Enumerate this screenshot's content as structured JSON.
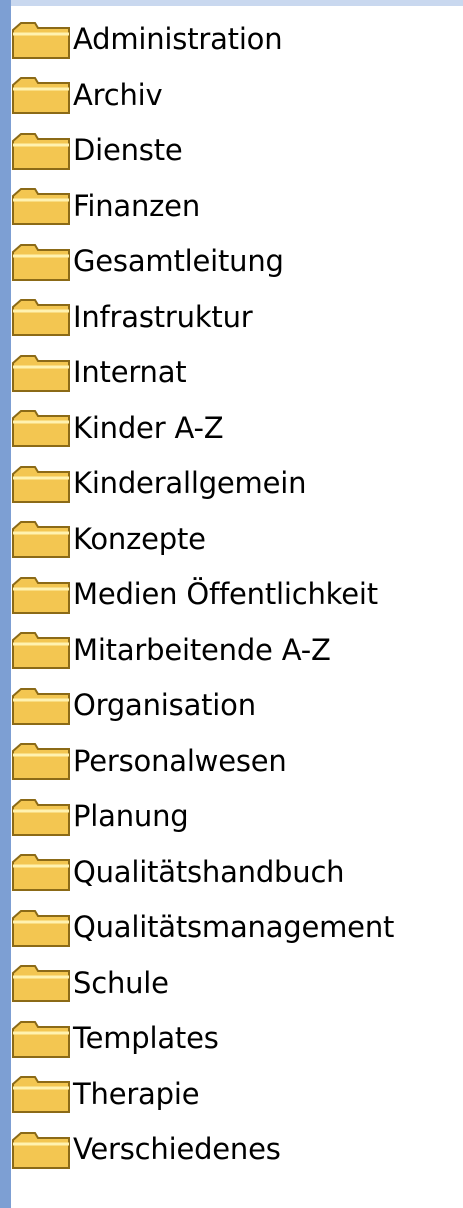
{
  "folder_tree": {
    "icon": "folder-icon",
    "colors": {
      "left_edge": "#7d9fd3",
      "folder_fill": "#f3c651",
      "folder_light": "#fff2b0",
      "folder_outline": "#8b6a17"
    },
    "items": [
      {
        "label": "Administration"
      },
      {
        "label": "Archiv"
      },
      {
        "label": "Dienste"
      },
      {
        "label": "Finanzen"
      },
      {
        "label": "Gesamtleitung"
      },
      {
        "label": "Infrastruktur"
      },
      {
        "label": "Internat"
      },
      {
        "label": "Kinder A-Z"
      },
      {
        "label": "Kinderallgemein"
      },
      {
        "label": "Konzepte"
      },
      {
        "label": "Medien Öffentlichkeit"
      },
      {
        "label": "Mitarbeitende A-Z"
      },
      {
        "label": "Organisation"
      },
      {
        "label": "Personalwesen"
      },
      {
        "label": "Planung"
      },
      {
        "label": "Qualitätshandbuch"
      },
      {
        "label": "Qualitätsmanagement"
      },
      {
        "label": "Schule"
      },
      {
        "label": "Templates"
      },
      {
        "label": "Therapie"
      },
      {
        "label": "Verschiedenes"
      }
    ]
  }
}
